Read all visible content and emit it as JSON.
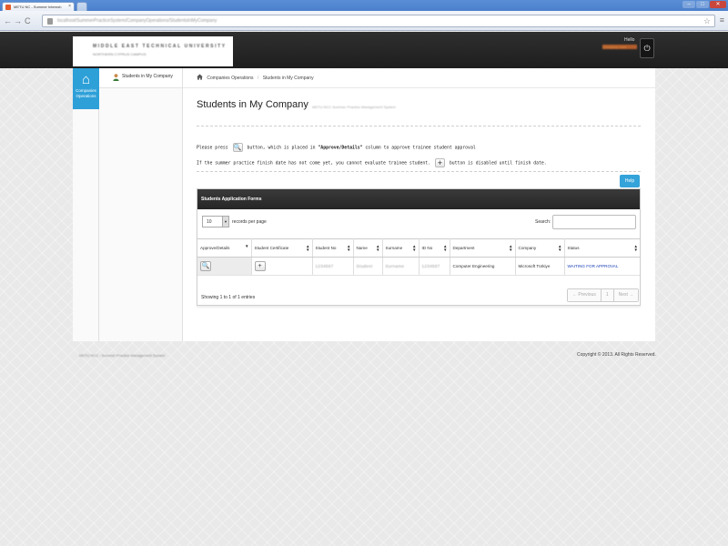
{
  "browser": {
    "tab_title": "METU NC - Summer Internsh",
    "tab_close": "×",
    "url": "localhost/SummerPracticeSystem/CompanyOperations/StudentsInMyCompany",
    "back": "←",
    "forward": "→",
    "reload": "C",
    "star": "☆",
    "menu": "≡",
    "min": "–",
    "max": "□",
    "close": "✕"
  },
  "header": {
    "logo_line1": "MIDDLE EAST TECHNICAL UNIVERSITY",
    "logo_line2": "NORTHERN CYPRUS CAMPUS",
    "hello": "Hello",
    "user_name": "Company User",
    "power": "⏻"
  },
  "rail": {
    "icon": "home-icon",
    "label": "Companies Operations"
  },
  "subnav": {
    "item": "Students in My Company"
  },
  "breadcrumb": {
    "items": [
      "Companies Operations",
      "Students in My Company"
    ],
    "separator": "/"
  },
  "page": {
    "title": "Students in My Company",
    "subtitle": "METU NCC Summer Practice Management System"
  },
  "info": {
    "line1_prefix": "Please press",
    "line1_icon": "🔍",
    "line1_mid": "button, which is placed in",
    "line1_bold": "\"Approve/Details\"",
    "line1_suffix": "column to approve trainee student approval",
    "line2_prefix": "If the summer practice finish date has not come yet, you cannot evaluate trainee student.",
    "line2_icon": "+",
    "line2_suffix": "button is disabled until finish date."
  },
  "help": {
    "label": "Help"
  },
  "panel": {
    "title": "Students Application Forms",
    "length_value": "10",
    "length_arrow": "▼",
    "records_label": "records per page",
    "search_label": "Search:",
    "columns": [
      "Approve/Details",
      "Student Certificate",
      "Student No",
      "Name",
      "Surname",
      "ID No",
      "Department",
      "Company",
      "Status"
    ],
    "row": {
      "approve_icon": "🔍",
      "certificate_icon": "+",
      "student_no": "1234567",
      "name": "Student",
      "surname": "Surname",
      "id_no": "1234567",
      "department": "Computer Engineering",
      "company": "Microsoft Türkiye",
      "status": "WAITING FOR APPROVAL"
    },
    "showing": "Showing 1 to 1 of 1 entries",
    "pager": [
      "← Previous",
      "1",
      "Next →"
    ]
  },
  "footer": {
    "left": "METU NCC - Summer Practice Management System",
    "right": "Copyright © 2013. All Rights Reserved."
  }
}
